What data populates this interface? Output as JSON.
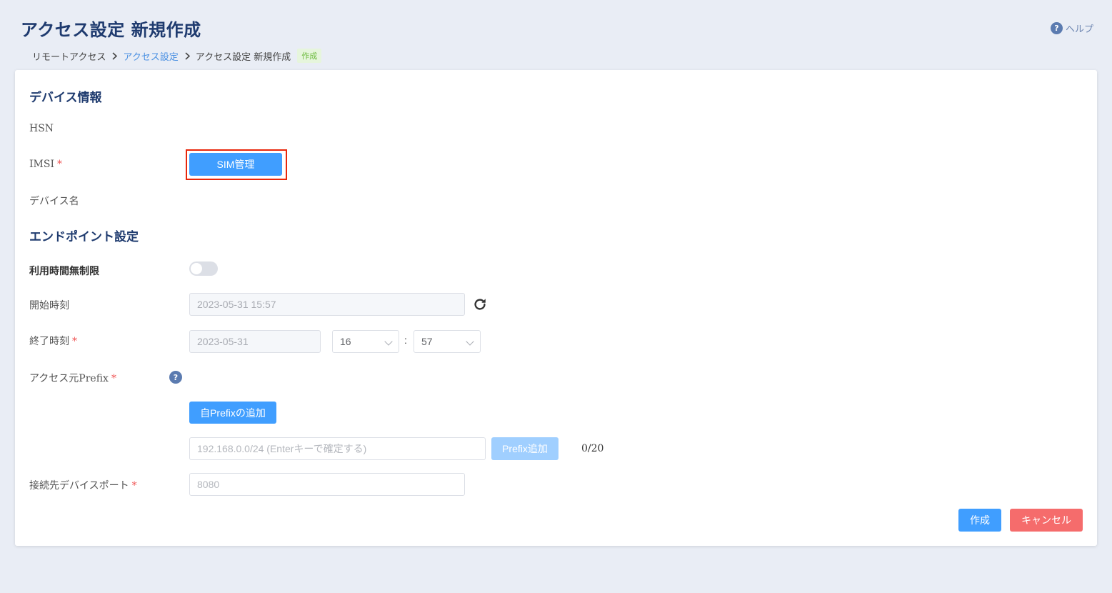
{
  "header": {
    "title": "アクセス設定 新規作成",
    "help_label": "ヘルプ"
  },
  "breadcrumb": {
    "items": [
      "リモートアクセス",
      "アクセス設定",
      "アクセス設定 新規作成"
    ],
    "tag": "作成"
  },
  "device_section": {
    "title": "デバイス情報",
    "hsn_label": "HSN",
    "imsi_label": "IMSI",
    "sim_button": "SIM管理",
    "device_name_label": "デバイス名"
  },
  "endpoint_section": {
    "title": "エンドポイント設定",
    "unlimited_label": "利用時間無制限",
    "unlimited_on": false,
    "start_label": "開始時刻",
    "start_value": "2023-05-31 15:57",
    "end_label": "終了時刻",
    "end_date": "2023-05-31",
    "end_hour": "16",
    "end_colon": ":",
    "end_minute": "57",
    "prefix_label": "アクセス元Prefix",
    "add_own_prefix": "自Prefixの追加",
    "prefix_placeholder": "192.168.0.0/24 (Enterキーで確定する)",
    "prefix_add_button": "Prefix追加",
    "prefix_count": "0/20",
    "port_label": "接続先デバイスポート",
    "port_placeholder": "8080"
  },
  "footer": {
    "create": "作成",
    "cancel": "キャンセル"
  },
  "required_mark": "*",
  "colors": {
    "primary": "#409eff",
    "danger": "#f56c6c",
    "title": "#1f3b6f",
    "highlight": "#e8260a"
  },
  "icons": [
    "help-icon",
    "chevron-right-icon",
    "refresh-icon",
    "chevron-down-icon"
  ]
}
